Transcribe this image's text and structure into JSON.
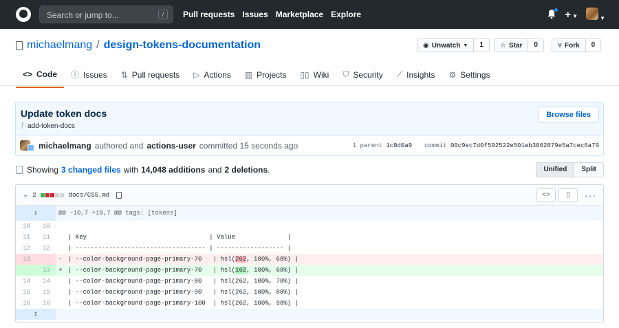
{
  "header": {
    "search_placeholder": "Search or jump to...",
    "search_shortcut": "/",
    "nav": [
      "Pull requests",
      "Issues",
      "Marketplace",
      "Explore"
    ],
    "plus_label": "+",
    "icons": [
      "github-logo-icon",
      "bell-icon",
      "plus-icon",
      "avatar"
    ]
  },
  "repo": {
    "owner": "michaelmang",
    "separator": "/",
    "name": "design-tokens-documentation",
    "watch_label": "Unwatch",
    "watch_count": "1",
    "star_label": "Star",
    "star_count": "0",
    "fork_label": "Fork",
    "fork_count": "0"
  },
  "tabs": [
    {
      "label": "Code",
      "icon": "code-icon",
      "active": true
    },
    {
      "label": "Issues",
      "icon": "issue-icon"
    },
    {
      "label": "Pull requests",
      "icon": "pull-request-icon"
    },
    {
      "label": "Actions",
      "icon": "play-icon"
    },
    {
      "label": "Projects",
      "icon": "project-icon"
    },
    {
      "label": "Wiki",
      "icon": "book-icon"
    },
    {
      "label": "Security",
      "icon": "shield-icon"
    },
    {
      "label": "Insights",
      "icon": "graph-icon"
    },
    {
      "label": "Settings",
      "icon": "gear-icon"
    }
  ],
  "commit": {
    "title": "Update token docs",
    "branch": "add-token-docs",
    "browse_label": "Browse files",
    "author": "michaelmang",
    "authored_text": "authored and",
    "committer": "actions-user",
    "committed_text": "committed 15 seconds ago",
    "parent_label": "1 parent",
    "parent_sha": "1c8d0a9",
    "commit_label": "commit",
    "commit_sha": "00c9ec7d0f592522e501eb3062879e5a7cec6a79"
  },
  "stats": {
    "showing": "Showing",
    "changed_files": "3 changed files",
    "with": "with",
    "additions": "14,048 additions",
    "and": "and",
    "deletions": "2 deletions",
    "period": ".",
    "unified_label": "Unified",
    "split_label": "Split"
  },
  "file": {
    "change_count": "2",
    "path": "docs/CSS.md",
    "hunk_header": "@@ -10,7 +10,7 @@ tags: [tokens]",
    "expand_up_icon": "expand-up-icon",
    "expand_down_icon": "expand-down-icon",
    "lines": [
      {
        "old": "10",
        "new": "10",
        "sign": "",
        "text": "",
        "type": "ctx"
      },
      {
        "old": "11",
        "new": "11",
        "sign": "",
        "text": "| Key                                 | Value              |",
        "type": "ctx"
      },
      {
        "old": "12",
        "new": "12",
        "sign": "",
        "text": "| ----------------------------------- | ------------------ |",
        "type": "ctx"
      },
      {
        "old": "13",
        "new": "",
        "sign": "-",
        "pre": "| --color-background-page-primary-70   | hsl(",
        "hl": "262",
        "post": ", 100%, 68%) |",
        "type": "del"
      },
      {
        "old": "",
        "new": "13",
        "sign": "+",
        "pre": "| --color-background-page-primary-70   | hsl(",
        "hl": "162",
        "post": ", 100%, 68%) |",
        "type": "add"
      },
      {
        "old": "14",
        "new": "14",
        "sign": "",
        "text": "| --color-background-page-primary-80   | hsl(262, 100%, 78%) |",
        "type": "ctx"
      },
      {
        "old": "15",
        "new": "15",
        "sign": "",
        "text": "| --color-background-page-primary-90   | hsl(262, 100%, 88%) |",
        "type": "ctx"
      },
      {
        "old": "16",
        "new": "16",
        "sign": "",
        "text": "| --color-background-page-primary-100  | hsl(262, 100%, 98%) |",
        "type": "ctx"
      }
    ]
  },
  "colors": {
    "header_bg": "#24292e",
    "link": "#0366d6",
    "tab_accent": "#e36209",
    "del_bg": "#ffeef0",
    "add_bg": "#e6ffed"
  }
}
